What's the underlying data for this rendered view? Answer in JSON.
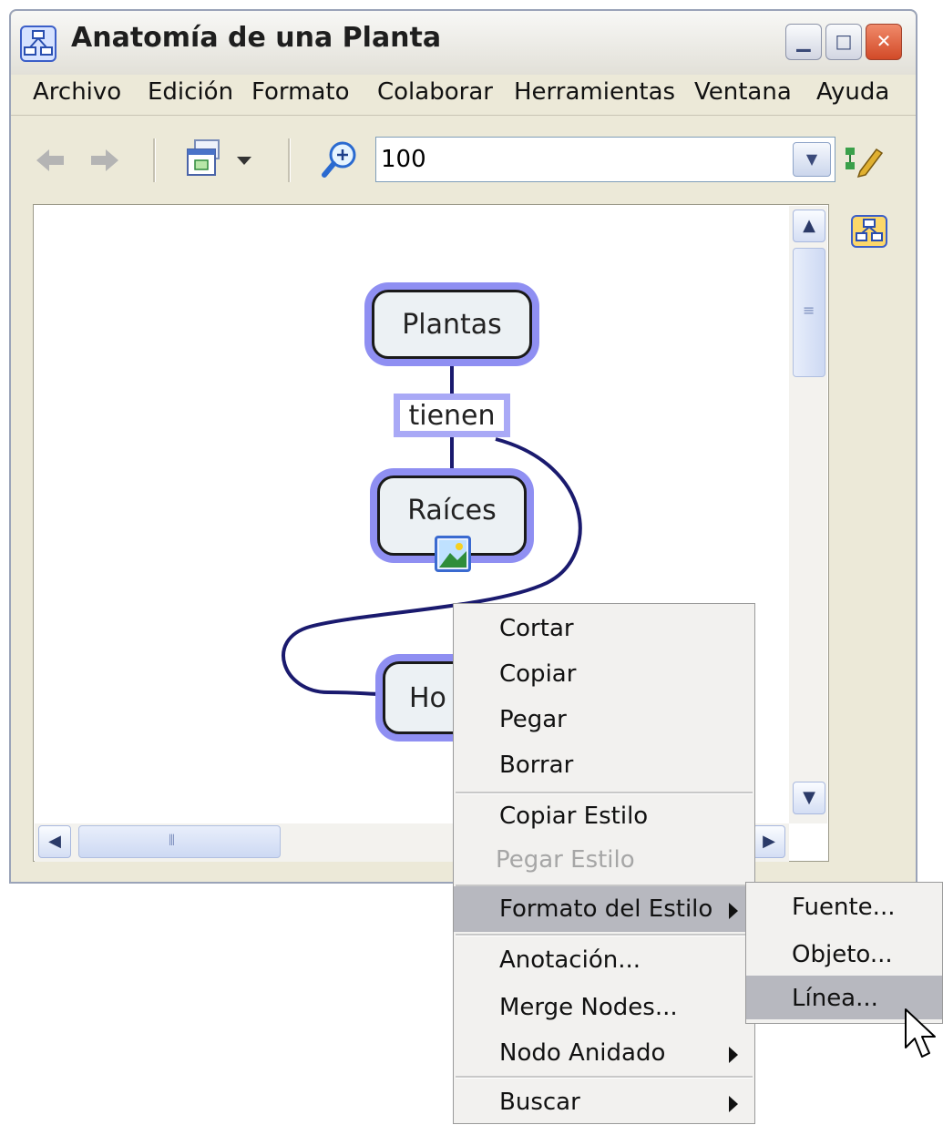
{
  "window": {
    "title": "Anatomía de una Planta"
  },
  "menubar": [
    "Archivo",
    "Edición",
    "Formato",
    "Colaborar",
    "Herramientas",
    "Ventana",
    "Ayuda"
  ],
  "toolbar": {
    "zoom_value": "100"
  },
  "concept_map": {
    "nodes": [
      "Plantas",
      "Raíces",
      "Ho"
    ],
    "linking_phrase": "tienen"
  },
  "context_menu": {
    "items": [
      {
        "label": "Cortar",
        "enabled": true,
        "submenu": false
      },
      {
        "label": "Copiar",
        "enabled": true,
        "submenu": false
      },
      {
        "label": "Pegar",
        "enabled": true,
        "submenu": false
      },
      {
        "label": "Borrar",
        "enabled": true,
        "submenu": false
      },
      {
        "label": "Copiar Estilo",
        "enabled": true,
        "submenu": false
      },
      {
        "label": "Pegar Estilo",
        "enabled": false,
        "submenu": false
      },
      {
        "label": "Formato del Estilo",
        "enabled": true,
        "submenu": true,
        "highlighted": true
      },
      {
        "label": "Anotación...",
        "enabled": true,
        "submenu": false
      },
      {
        "label": "Merge Nodes...",
        "enabled": true,
        "submenu": false
      },
      {
        "label": "Nodo Anidado",
        "enabled": true,
        "submenu": true
      },
      {
        "label": "Buscar",
        "enabled": true,
        "submenu": true
      }
    ]
  },
  "submenu": {
    "items": [
      {
        "label": "Fuente..."
      },
      {
        "label": "Objeto..."
      },
      {
        "label": "Línea...",
        "highlighted": true
      }
    ]
  },
  "colors": {
    "node_glow": "#8f8ff2",
    "connection_line": "#1a1a6e",
    "menu_highlight": "#b7b8bf"
  }
}
